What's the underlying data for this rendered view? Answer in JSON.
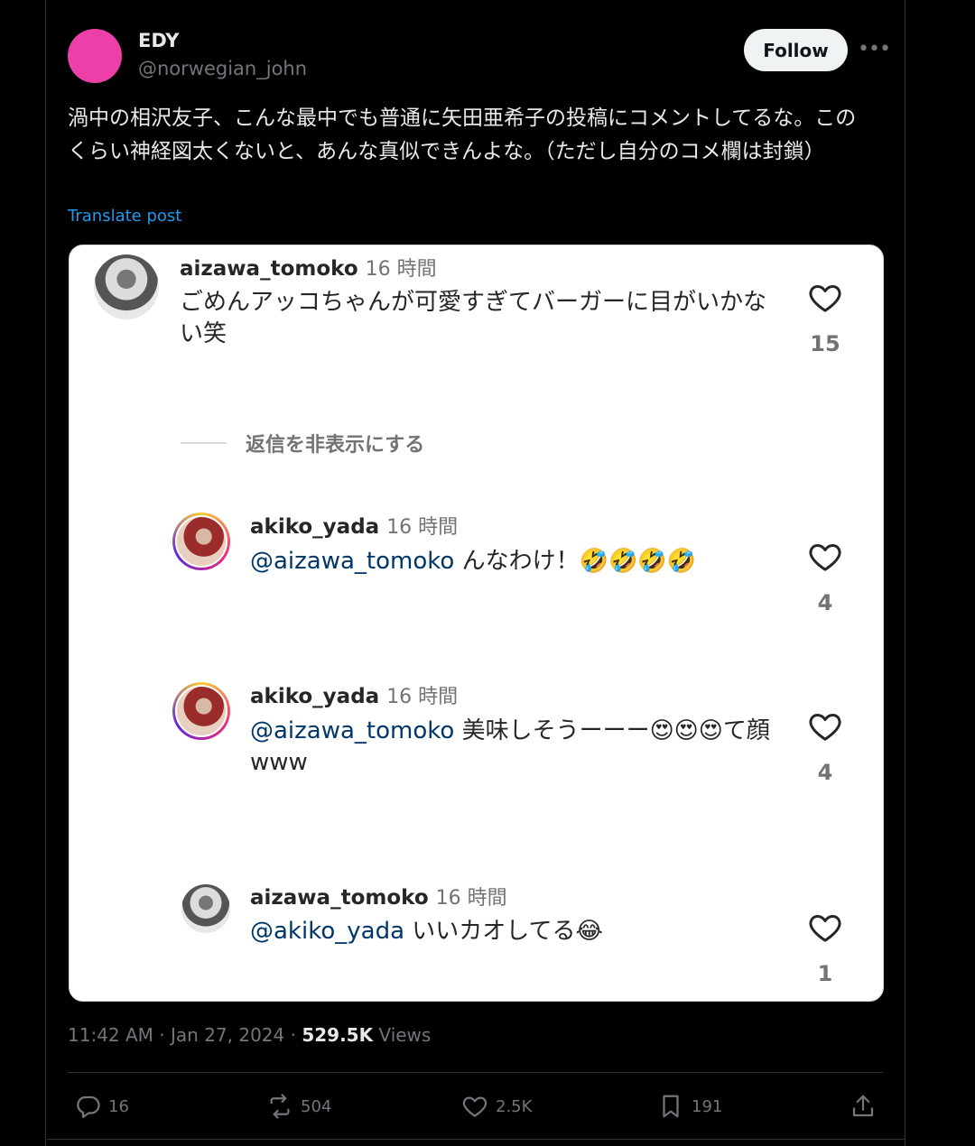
{
  "post": {
    "display_name": "EDY",
    "handle": "@norwegian_john",
    "follow_label": "Follow",
    "text": "渦中の相沢友子、こんな最中でも普通に矢田亜希子の投稿にコメントしてるな。このくらい神経図太くないと、あんな真似できんよな。（ただし自分のコメ欄は封鎖）",
    "translate_label": "Translate post",
    "time": "11:42 AM · Jan 27, 2024 · ",
    "views_count": "529.5K",
    "views_label": " Views",
    "avatar_color": "#ec3fa7"
  },
  "comments": {
    "c1": {
      "user": "aizawa_tomoko",
      "time": "16 時間",
      "text": "ごめんアッコちゃんが可愛すぎてバーガーに目がいかない笑",
      "likes": "15"
    },
    "hide_replies": "返信を非表示にする",
    "c2": {
      "user": "akiko_yada",
      "time": "16 時間",
      "mention": "@aizawa_tomoko",
      "text": " んなわけ！🤣🤣🤣🤣",
      "likes": "4"
    },
    "c3": {
      "user": "akiko_yada",
      "time": "16 時間",
      "mention": "@aizawa_tomoko",
      "text": " 美味しそうーーー😍😍😍て顔www",
      "likes": "4"
    },
    "c4": {
      "user": "aizawa_tomoko",
      "time": "16 時間",
      "mention": "@akiko_yada",
      "text": " いいカオしてる😂",
      "likes": "1"
    }
  },
  "actions": {
    "replies": "16",
    "reposts": "504",
    "likes": "2.5K",
    "bookmarks": "191"
  }
}
